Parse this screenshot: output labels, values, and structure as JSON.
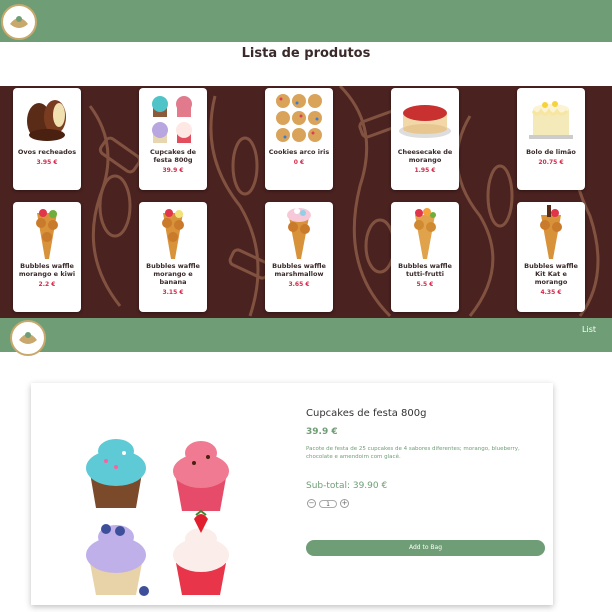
{
  "header": {
    "logo_icon": "bakery-logo-icon"
  },
  "page": {
    "title": "Lista de produtos"
  },
  "products": [
    {
      "name": "Ovos recheados",
      "price": "3.95 €",
      "icon": "chocolate-eggs"
    },
    {
      "name": "Cupcakes de festa 800g",
      "price": "39.9 €",
      "icon": "cupcakes"
    },
    {
      "name": "Cookies arco iris",
      "price": "0 €",
      "icon": "cookies"
    },
    {
      "name": "Cheesecake de morango",
      "price": "1.95 €",
      "icon": "cheesecake"
    },
    {
      "name": "Bolo de limão",
      "price": "20.75 €",
      "icon": "lemon-cake"
    },
    {
      "name": "Bubbles waffle morango e kiwi",
      "price": "2.2 €",
      "icon": "waffle"
    },
    {
      "name": "Bubbles waffle morango e banana",
      "price": "3.15 €",
      "icon": "waffle"
    },
    {
      "name": "Bubbles waffle marshmallow",
      "price": "3.65 €",
      "icon": "waffle"
    },
    {
      "name": "Bubbles waffle tutti-frutti",
      "price": "5.5 €",
      "icon": "waffle"
    },
    {
      "name": "Bubbles waffle Kit Kat e morango",
      "price": "4.35 €",
      "icon": "waffle"
    }
  ],
  "nav": {
    "list_label": "List"
  },
  "detail": {
    "title": "Cupcakes de festa 800g",
    "price": "39.9 €",
    "description": "Pacote de festa de 25 cupcakes de 4 sabores diferentes; morango, blueberry, chocolate e amendoim com glacê.",
    "subtotal": "Sub-total: 39.90 €",
    "quantity": "1",
    "minus_label": "−",
    "plus_label": "+",
    "add_label": "Add to Bag"
  },
  "colors": {
    "brand_green": "#6f9e76",
    "brown_bg": "#4a2220",
    "price_red": "#d22b4b"
  }
}
